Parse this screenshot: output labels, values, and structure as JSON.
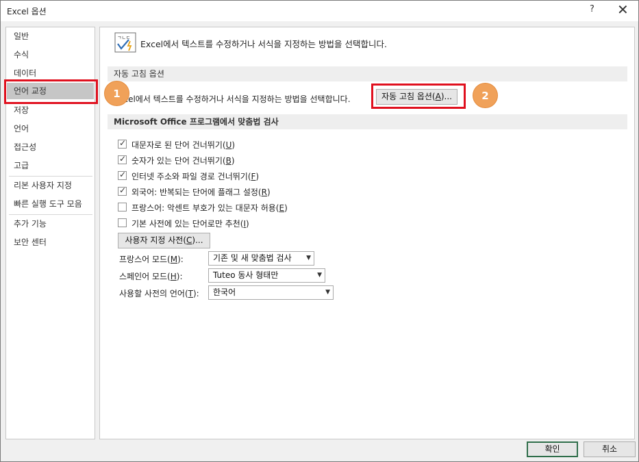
{
  "window": {
    "title": "Excel 옵션",
    "help_label": "?",
    "close_label": "✕"
  },
  "nav": {
    "items": [
      {
        "label": "일반"
      },
      {
        "label": "수식"
      },
      {
        "label": "데이터"
      },
      {
        "label": "언어 교정",
        "selected": true
      },
      {
        "label": "저장"
      },
      {
        "label": "언어"
      },
      {
        "label": "접근성"
      },
      {
        "label": "고급"
      },
      {
        "label": "리본 사용자 지정"
      },
      {
        "label": "빠른 실행 도구 모음"
      },
      {
        "label": "추가 기능"
      },
      {
        "label": "보안 센터"
      }
    ]
  },
  "main": {
    "header_icon": "abc-check-icon",
    "header_text": "Excel에서 텍스트를 수정하거나 서식을 지정하는 방법을 선택합니다.",
    "autocorrect_section": {
      "title": "자동 고침 옵션",
      "description": "Excel에서 텍스트를 수정하거나 서식을 지정하는 방법을 선택합니다.",
      "button_label": "자동 고침 옵션(",
      "button_key": "A",
      "button_suffix": ")..."
    },
    "spelling_section": {
      "title": "Microsoft Office 프로그램에서 맞춤법 검사",
      "options": [
        {
          "label": "대문자로 된 단어 건너뛰기(",
          "key": "U",
          "checked": true
        },
        {
          "label": "숫자가 있는 단어 건너뛰기(",
          "key": "B",
          "checked": true
        },
        {
          "label": "인터넷 주소와 파일 경로 건너뛰기(",
          "key": "F",
          "checked": true
        },
        {
          "label": "외국어: 반복되는 단어에 플래그 설정(",
          "key": "R",
          "checked": true
        },
        {
          "label": "프랑스어: 악센트 부호가 있는 대문자 허용(",
          "key": "E",
          "checked": false
        },
        {
          "label": "기본 사전에 있는 단어로만 추천(",
          "key": "I",
          "checked": false
        }
      ],
      "custom_dict_button": "사용자 지정 사전(",
      "custom_dict_key": "C",
      "custom_dict_suffix": ")...",
      "french_mode_label": "프랑스어 모드(",
      "french_mode_key": "M",
      "french_mode_value": "기존 및 새 맞춤법 검사",
      "spanish_mode_label": "스페인어 모드(",
      "spanish_mode_key": "H",
      "spanish_mode_value": "Tuteo 동사 형태만",
      "dict_language_label": "사용할 사전의 언어(",
      "dict_language_key": "T",
      "dict_language_value": "한국어"
    }
  },
  "footer": {
    "ok_label": "확인",
    "cancel_label": "취소"
  },
  "annotations": {
    "badge_1": "1",
    "badge_2": "2",
    "highlight_color": "#e0101e",
    "badge_color": "#f0a159"
  }
}
